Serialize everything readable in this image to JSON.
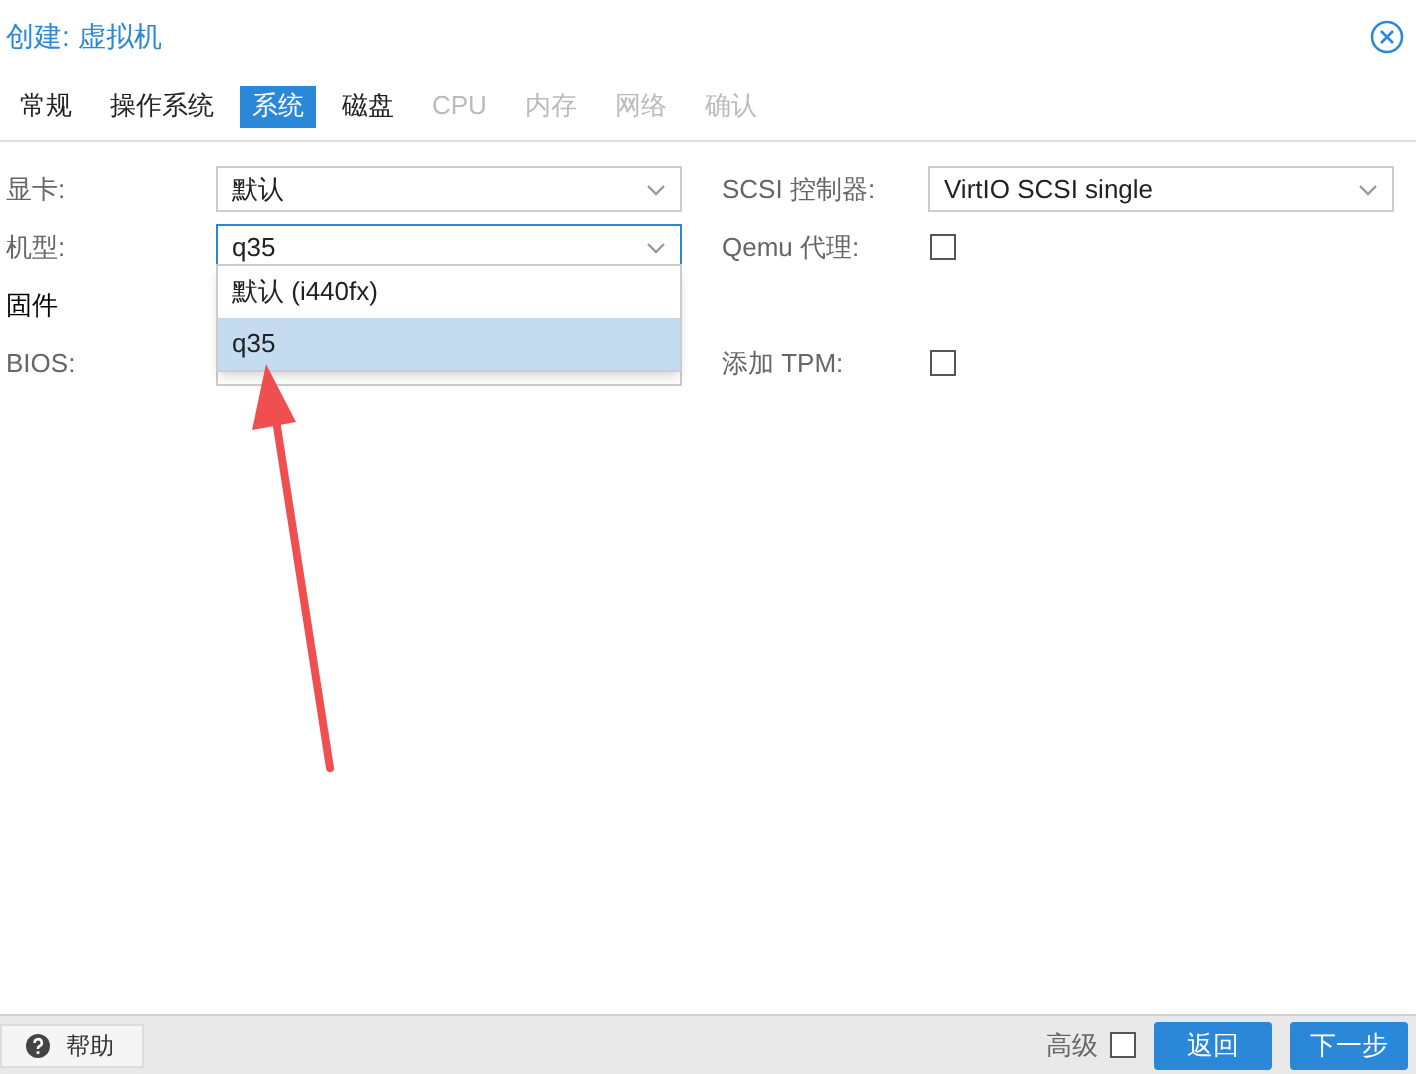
{
  "window": {
    "title": "创建: 虚拟机"
  },
  "tabs": [
    {
      "label": "常规",
      "selected": false,
      "disabled": false
    },
    {
      "label": "操作系统",
      "selected": false,
      "disabled": false
    },
    {
      "label": "系统",
      "selected": true,
      "disabled": false
    },
    {
      "label": "磁盘",
      "selected": false,
      "disabled": false
    },
    {
      "label": "CPU",
      "selected": false,
      "disabled": true
    },
    {
      "label": "内存",
      "selected": false,
      "disabled": true
    },
    {
      "label": "网络",
      "selected": false,
      "disabled": true
    },
    {
      "label": "确认",
      "selected": false,
      "disabled": true
    }
  ],
  "left_fields": [
    {
      "kind": "select",
      "label": "显卡:",
      "value": "默认"
    },
    {
      "kind": "select",
      "label": "机型:",
      "value": "q35",
      "focused": true
    },
    {
      "kind": "heading",
      "label": "固件"
    },
    {
      "kind": "select",
      "label": "BIOS:"
    }
  ],
  "right_fields": [
    {
      "kind": "select",
      "label": "SCSI 控制器:",
      "value": "VirtIO SCSI single"
    },
    {
      "kind": "checkbox",
      "label": "Qemu 代理:",
      "checked": false
    },
    {
      "kind": "blank"
    },
    {
      "kind": "checkbox",
      "label": "添加 TPM:",
      "checked": false
    }
  ],
  "dropdown": {
    "options": [
      {
        "label": "默认 (i440fx)",
        "selected": false
      },
      {
        "label": "q35",
        "selected": true
      }
    ]
  },
  "footer": {
    "help": "帮助",
    "advanced": {
      "label": "高级",
      "checked": false
    },
    "buttons": [
      "返回",
      "下一步"
    ]
  }
}
